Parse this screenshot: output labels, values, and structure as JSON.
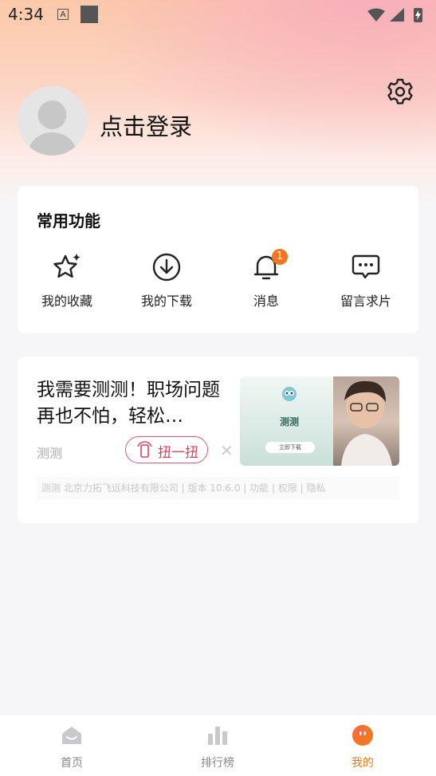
{
  "status_bar": {
    "time": "4:34",
    "notif_a": "A"
  },
  "profile": {
    "login_text": "点击登录"
  },
  "common_functions": {
    "title": "常用功能",
    "items": [
      {
        "label": "我的收藏",
        "icon": "star-sparkle-icon"
      },
      {
        "label": "我的下载",
        "icon": "download-icon"
      },
      {
        "label": "消息",
        "icon": "bell-icon",
        "badge": "1"
      },
      {
        "label": "留言求片",
        "icon": "chat-bubble-icon"
      }
    ]
  },
  "ad": {
    "headline": "我需要测测！职场问题再也不怕，轻松…",
    "brand": "测测",
    "twist_label": "扭一扭",
    "image_title": "测测",
    "image_button": "立即下载",
    "meta": "测测 北京力拓飞远科技有限公司 | 版本 10.6.0 | 功能 | 权限 | 隐私"
  },
  "tabbar": {
    "items": [
      {
        "label": "首页",
        "icon": "home-icon"
      },
      {
        "label": "排行榜",
        "icon": "ranking-bars-icon"
      },
      {
        "label": "我的",
        "icon": "my-face-icon",
        "active": true
      }
    ]
  },
  "colors": {
    "accent": "#f27a1a",
    "badge": "#f4751f",
    "twist": "#e0405f"
  }
}
